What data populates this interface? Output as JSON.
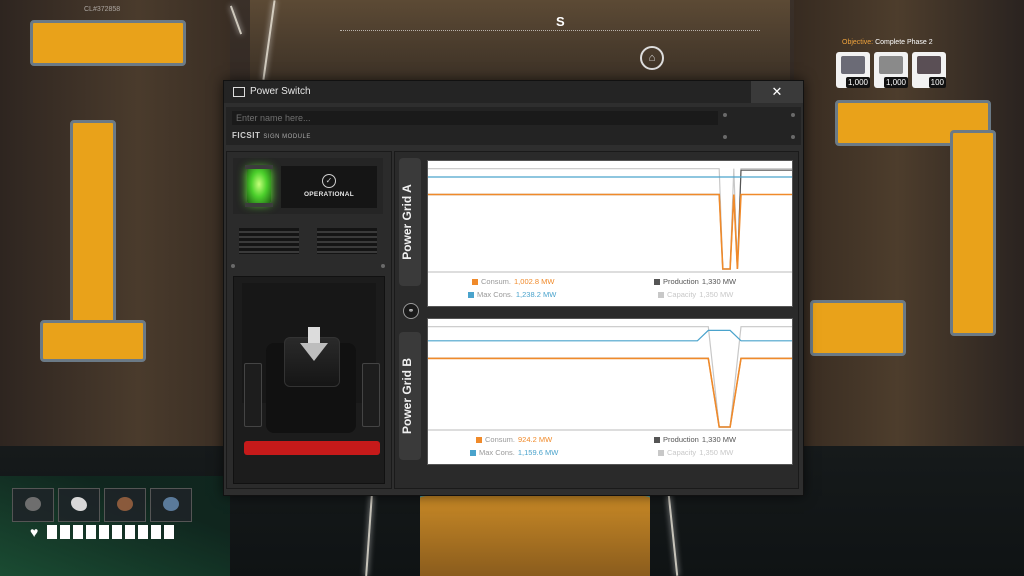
{
  "hud": {
    "build_id": "CL#372858",
    "compass": "S",
    "objective_label": "Objective:",
    "objective_text": "Complete Phase 2",
    "objective_items": [
      {
        "icon": "modular-frame-icon",
        "count": "1,000"
      },
      {
        "icon": "rotor-icon",
        "count": "1,000"
      },
      {
        "icon": "smart-plating-icon",
        "count": "100"
      }
    ],
    "hotbar": [
      {
        "icon": "mug-icon"
      },
      {
        "icon": "xeno-zapper-icon"
      },
      {
        "icon": "berry-icon"
      },
      {
        "icon": "mushroom-icon"
      }
    ],
    "health_segments": 10
  },
  "window": {
    "title": "Power Switch",
    "close_label": "✕",
    "name_placeholder": "Enter name here...",
    "brand": "FICSIT",
    "brand_sub": "SIGN MODULE",
    "status": "OPERATIONAL",
    "switch_state": "on"
  },
  "colors": {
    "consumption": "#f08a2a",
    "max_consumption": "#4aa3cc",
    "production": "#555555",
    "capacity": "#c8c8c8",
    "indicator": "#4cd02c",
    "switch_base": "#c61a1a"
  },
  "grids": [
    {
      "name": "Power Grid A",
      "consumption_label": "Consum.",
      "consumption": "1,002.8 MW",
      "production_label": "Production",
      "production": "1,330 MW",
      "max_consumption_label": "Max Cons.",
      "max_consumption": "1,238.2 MW",
      "capacity_label": "Capacity",
      "capacity": "1,350 MW"
    },
    {
      "name": "Power Grid B",
      "consumption_label": "Consum.",
      "consumption": "924.2 MW",
      "production_label": "Production",
      "production": "1,330 MW",
      "max_consumption_label": "Max Cons.",
      "max_consumption": "1,159.6 MW",
      "capacity_label": "Capacity",
      "capacity": "1,350 MW"
    }
  ],
  "chart_data": [
    {
      "type": "line",
      "title": "Power Grid A",
      "x": [
        0,
        40,
        80,
        81,
        83,
        84,
        85,
        86,
        90,
        100
      ],
      "series": [
        {
          "name": "Consum.",
          "values": [
            1003,
            1003,
            1003,
            0,
            0,
            1003,
            0,
            1003,
            1003,
            1003
          ]
        },
        {
          "name": "Max Cons.",
          "values": [
            1238,
            1238,
            1238,
            1238,
            1238,
            1238,
            1238,
            1238,
            1238,
            1238
          ]
        },
        {
          "name": "Production",
          "values": [
            1003,
            1003,
            1003,
            0,
            0,
            1003,
            0,
            1330,
            1330,
            1330
          ]
        },
        {
          "name": "Capacity",
          "values": [
            1350,
            1350,
            1350,
            0,
            0,
            1350,
            0,
            1350,
            1350,
            1350
          ]
        }
      ],
      "ylim": [
        0,
        1400
      ]
    },
    {
      "type": "line",
      "title": "Power Grid B",
      "x": [
        0,
        40,
        74,
        77,
        80,
        83,
        86,
        90,
        100
      ],
      "series": [
        {
          "name": "Consum.",
          "values": [
            924,
            924,
            924,
            924,
            0,
            0,
            924,
            924,
            924
          ]
        },
        {
          "name": "Max Cons.",
          "values": [
            1160,
            1160,
            1160,
            1300,
            1300,
            1300,
            1160,
            1160,
            1160
          ]
        },
        {
          "name": "Production",
          "values": [
            924,
            924,
            924,
            924,
            0,
            0,
            924,
            924,
            924
          ]
        },
        {
          "name": "Capacity",
          "values": [
            1350,
            1350,
            1350,
            1350,
            0,
            0,
            1350,
            1350,
            1350
          ]
        }
      ],
      "ylim": [
        0,
        1400
      ]
    }
  ]
}
